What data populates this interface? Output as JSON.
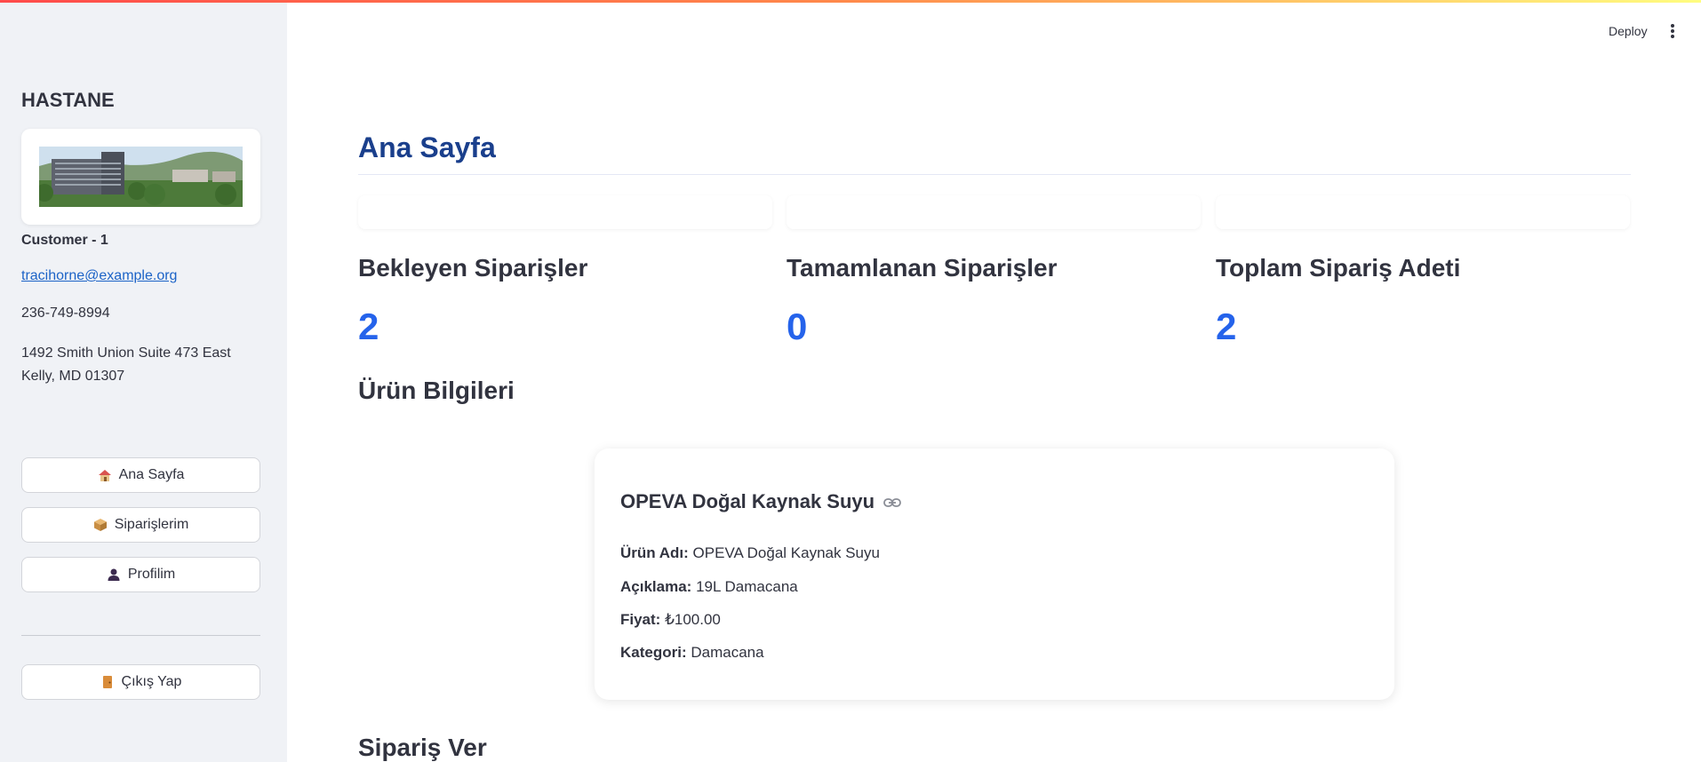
{
  "sidebar": {
    "title": "HASTANE",
    "customer_name": "Customer - 1",
    "email": "tracihorne@example.org",
    "phone": "236-749-8994",
    "address_line1": "1492 Smith Union Suite 473 East",
    "address_line2": "Kelly, MD 01307",
    "nav": [
      {
        "label": "Ana Sayfa",
        "icon": "house-icon"
      },
      {
        "label": "Siparişlerim",
        "icon": "package-icon"
      },
      {
        "label": "Profilim",
        "icon": "user-icon"
      }
    ],
    "logout_label": "Çıkış Yap",
    "logout_icon": "door-icon"
  },
  "header": {
    "deploy_label": "Deploy",
    "menu_icon": "vertical-dots-icon"
  },
  "main": {
    "page_title": "Ana Sayfa",
    "metrics": [
      {
        "label": "Bekleyen Siparişler",
        "value": "2"
      },
      {
        "label": "Tamamlanan Siparişler",
        "value": "0"
      },
      {
        "label": "Toplam Sipariş Adeti",
        "value": "2"
      }
    ],
    "product_section_title": "Ürün Bilgileri",
    "product": {
      "title": "OPEVA Doğal Kaynak Suyu",
      "link_icon": "link-icon",
      "name_label": "Ürün Adı:",
      "name_value": "OPEVA Doğal Kaynak Suyu",
      "desc_label": "Açıklama:",
      "desc_value": "19L Damacana",
      "price_label": "Fiyat:",
      "price_value": "₺100.00",
      "category_label": "Kategori:",
      "category_value": "Damacana"
    },
    "order_section_title": "Sipariş Ver"
  },
  "colors": {
    "accent_blue": "#2563eb",
    "title_navy": "#1a3f8c",
    "sidebar_bg": "#f0f2f6"
  }
}
